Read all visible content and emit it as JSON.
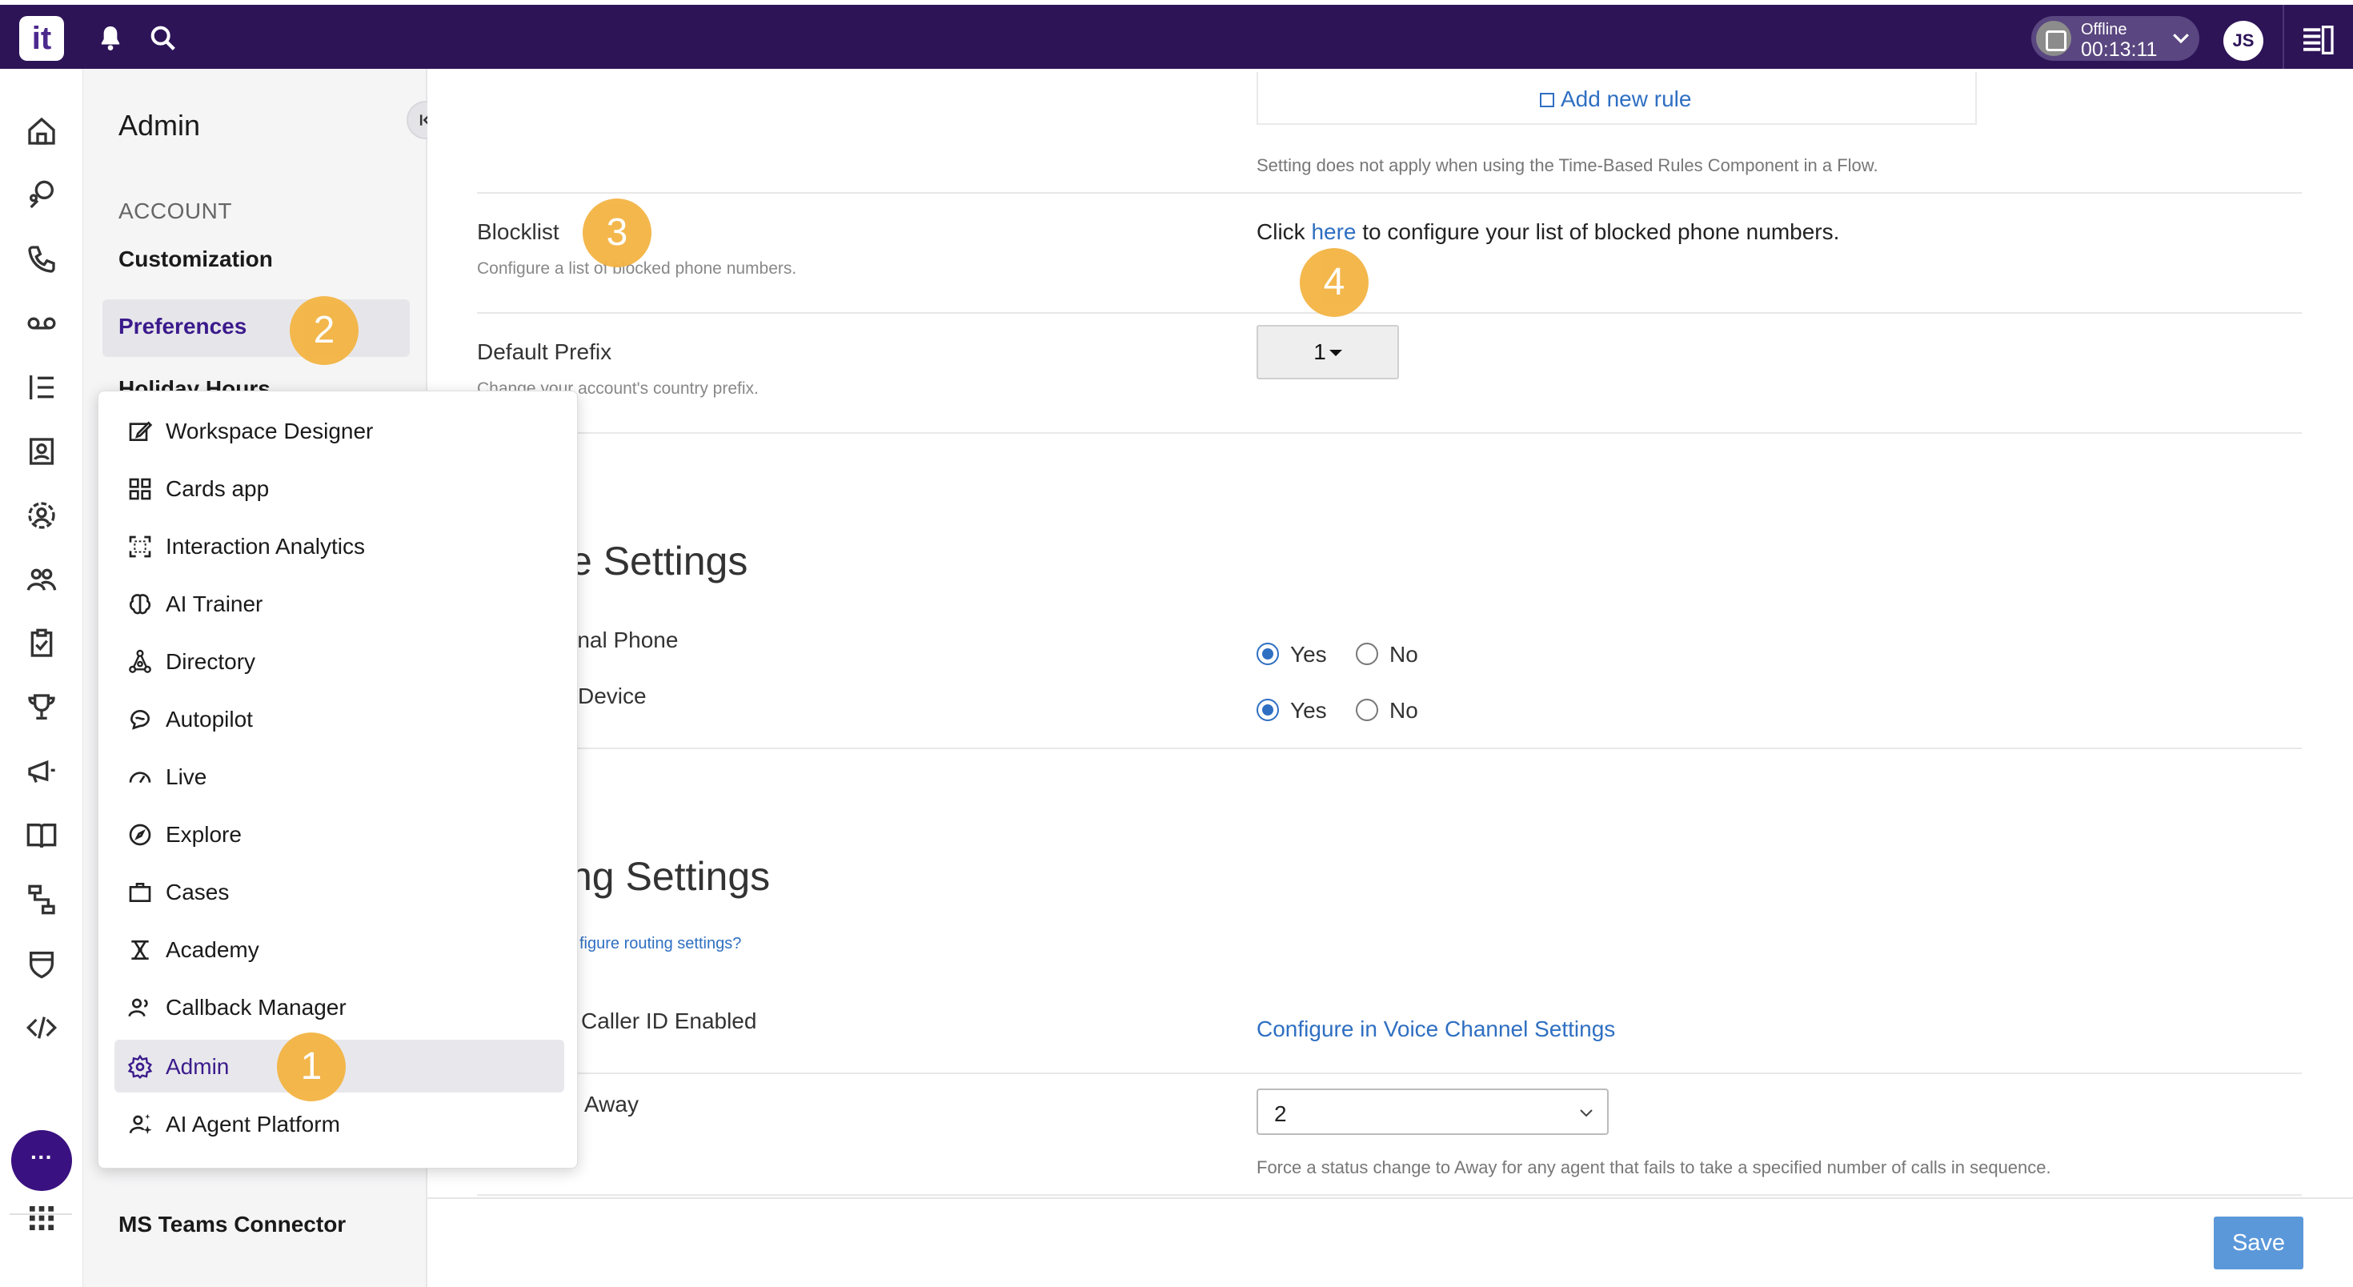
{
  "topbar": {
    "logo": "it",
    "status_label": "Offline",
    "status_time": "00:13:11",
    "avatar_initials": "JS"
  },
  "admin_panel": {
    "title": "Admin",
    "section": "ACCOUNT",
    "items": [
      "Customization",
      "Preferences",
      "Holiday Hours",
      "MS Teams Connector"
    ],
    "active_item": "Preferences"
  },
  "content": {
    "add_rule_label": "Add new rule",
    "time_rules_note": "Setting does not apply when using the Time-Based Rules Component in a Flow.",
    "blocklist": {
      "label": "Blocklist",
      "sublabel": "Configure a list of blocked phone numbers.",
      "text_before": "Click",
      "link": "here",
      "text_after": "to configure your list of blocked phone numbers."
    },
    "default_prefix": {
      "label": "Default Prefix",
      "sublabel": "Change your account's country prefix.",
      "value": "1"
    },
    "device_settings": {
      "title": "e Settings",
      "row1_label": "rnal Phone",
      "row2_label": "Device",
      "row1_selected": "Yes",
      "row2_selected": "Yes",
      "yes": "Yes",
      "no": "No"
    },
    "routing_settings": {
      "title": "ng Settings",
      "help_link": "figure routing settings?",
      "caller_id_label": "Caller ID Enabled",
      "caller_id_link": "Configure in Voice Channel Settings",
      "away_label": "Away",
      "away_value": "2",
      "away_note": "Force a status change to Away for any agent that fails to take a specified number of calls in sequence."
    }
  },
  "menu": {
    "items": [
      {
        "label": "Workspace Designer",
        "icon": "edit-icon"
      },
      {
        "label": "Cards app",
        "icon": "grid-icon"
      },
      {
        "label": "Interaction Analytics",
        "icon": "scan-icon"
      },
      {
        "label": "AI Trainer",
        "icon": "brain-icon"
      },
      {
        "label": "Directory",
        "icon": "network-icon"
      },
      {
        "label": "Autopilot",
        "icon": "chat-icon"
      },
      {
        "label": "Live",
        "icon": "gauge-icon"
      },
      {
        "label": "Explore",
        "icon": "compass-icon"
      },
      {
        "label": "Cases",
        "icon": "briefcase-icon"
      },
      {
        "label": "Academy",
        "icon": "academy-icon"
      },
      {
        "label": "Callback Manager",
        "icon": "users-icon"
      },
      {
        "label": "Admin",
        "icon": "gear-icon"
      },
      {
        "label": "AI Agent Platform",
        "icon": "ai-agent-icon"
      }
    ],
    "active_item": "Admin"
  },
  "badges": [
    "1",
    "2",
    "3",
    "4"
  ],
  "footer": {
    "save_label": "Save"
  },
  "colors": {
    "topbar": "#2d1457",
    "accent": "#3b1a8c",
    "link": "#2f6fc2",
    "badge": "#f3b443",
    "save": "#5b98da"
  }
}
